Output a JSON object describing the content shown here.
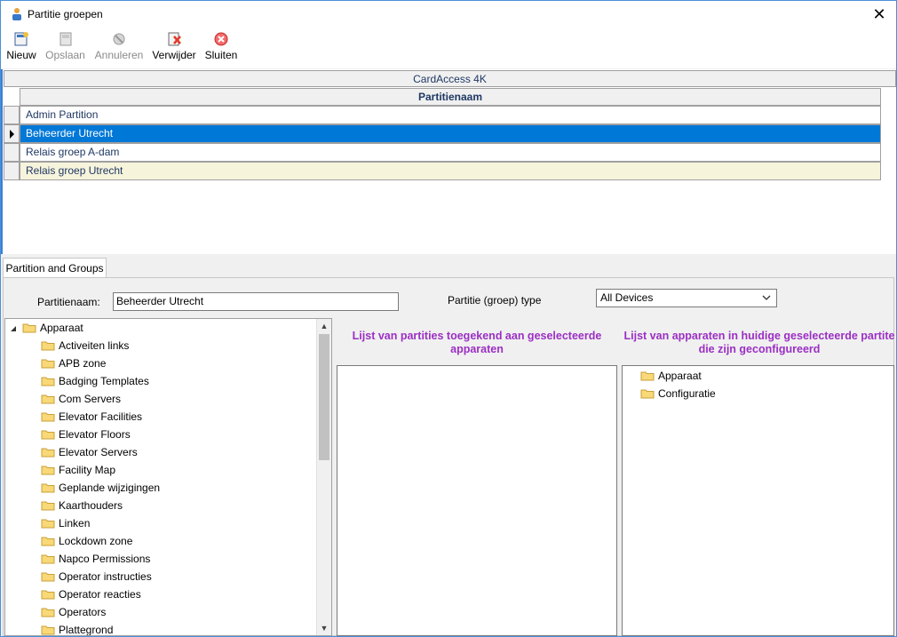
{
  "window": {
    "title": "Partitie groepen",
    "close_glyph": "✕"
  },
  "toolbar": {
    "new_label": "Nieuw",
    "save_label": "Opslaan",
    "cancel_label": "Annuleren",
    "delete_label": "Verwijder",
    "close_label": "Sluiten"
  },
  "grid": {
    "caption": "CardAccess 4K",
    "column_header": "Partitienaam",
    "rows": [
      {
        "name": "Admin Partition"
      },
      {
        "name": "Beheerder Utrecht",
        "selected": true
      },
      {
        "name": "Relais groep A-dam"
      },
      {
        "name": "Relais groep Utrecht"
      }
    ]
  },
  "tabs": {
    "active": "Partition and Groups"
  },
  "form": {
    "name_label": "Partitienaam:",
    "name_value": "Beheerder Utrecht",
    "type_label": "Partitie (groep) type",
    "type_value": "All Devices"
  },
  "tree": {
    "root": "Apparaat",
    "children": [
      "Activeiten links",
      "APB zone",
      "Badging Templates",
      "Com Servers",
      "Elevator Facilities",
      "Elevator Floors",
      "Elevator Servers",
      "Facility Map",
      "Geplande wijzigingen",
      "Kaarthouders",
      "Linken",
      "Lockdown zone",
      "Napco Permissions",
      "Operator instructies",
      "Operator reacties",
      "Operators",
      "Plattegrond"
    ]
  },
  "middle_panel": {
    "title": "Lijst van partities toegekend aan geselecteerde apparaten"
  },
  "right_panel": {
    "title": "Lijst van apparaten in huidige geselecteerde partite die zijn geconfigureerd",
    "items": [
      "Apparaat",
      "Configuratie"
    ]
  },
  "colors": {
    "selection": "#0078d7",
    "panel_title": "#9b2fc4",
    "alt_row": "#f7f4dc"
  }
}
